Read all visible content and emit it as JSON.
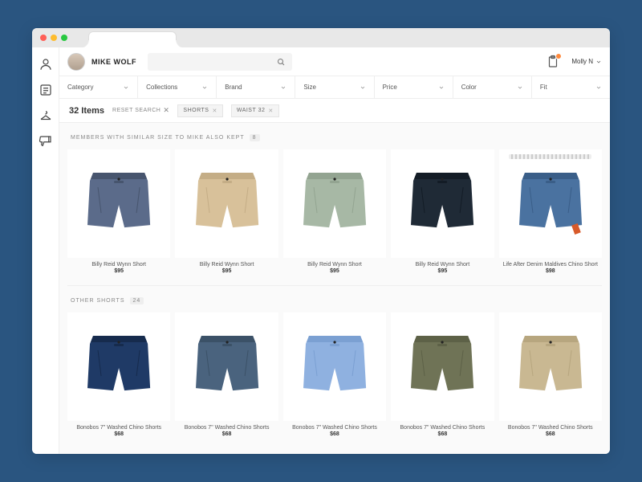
{
  "client": {
    "name": "MIKE WOLF"
  },
  "stylist": {
    "name": "Molly N"
  },
  "filters": [
    {
      "label": "Category"
    },
    {
      "label": "Collections"
    },
    {
      "label": "Brand"
    },
    {
      "label": "Size"
    },
    {
      "label": "Price"
    },
    {
      "label": "Color"
    },
    {
      "label": "Fit"
    }
  ],
  "results": {
    "count_label": "32 Items",
    "reset_label": "RESET SEARCH",
    "chips": [
      {
        "label": "SHORTS"
      },
      {
        "label": "WAIST 32"
      }
    ]
  },
  "section1": {
    "title": "MEMBERS WITH SIMILAR SIZE TO MIKE ALSO KEPT",
    "count": "8",
    "items": [
      {
        "name": "Billy Reid Wynn Short",
        "price": "$95",
        "color": "#5b6b8a",
        "shade": "#47556e"
      },
      {
        "name": "Billy Reid Wynn Short",
        "price": "$95",
        "color": "#d8c19a",
        "shade": "#c4ad86"
      },
      {
        "name": "Billy Reid Wynn Short",
        "price": "$95",
        "color": "#a7b8a5",
        "shade": "#93a491"
      },
      {
        "name": "Billy Reid Wynn Short",
        "price": "$95",
        "color": "#1f2a36",
        "shade": "#131c26"
      },
      {
        "name": "Life After Denim Maldives Chino Short",
        "price": "$98",
        "color": "#4a72a0",
        "shade": "#3a5e88",
        "belt": true,
        "tag": true
      }
    ]
  },
  "section2": {
    "title": "OTHER SHORTS",
    "count": "24",
    "items": [
      {
        "name": "Bonobos 7\" Washed Chino Shorts",
        "price": "$68",
        "color": "#1f3a66",
        "shade": "#162b4d"
      },
      {
        "name": "Bonobos 7\" Washed Chino Shorts",
        "price": "$68",
        "color": "#4a637e",
        "shade": "#3b5167"
      },
      {
        "name": "Bonobos 7\" Washed Chino Shorts",
        "price": "$68",
        "color": "#8fb1e0",
        "shade": "#7ba0d2"
      },
      {
        "name": "Bonobos 7\" Washed Chino Shorts",
        "price": "$68",
        "color": "#6f7356",
        "shade": "#5d6147"
      },
      {
        "name": "Bonobos 7\" Washed Chino Shorts",
        "price": "$68",
        "color": "#c9b892",
        "shade": "#b7a67f"
      }
    ]
  }
}
